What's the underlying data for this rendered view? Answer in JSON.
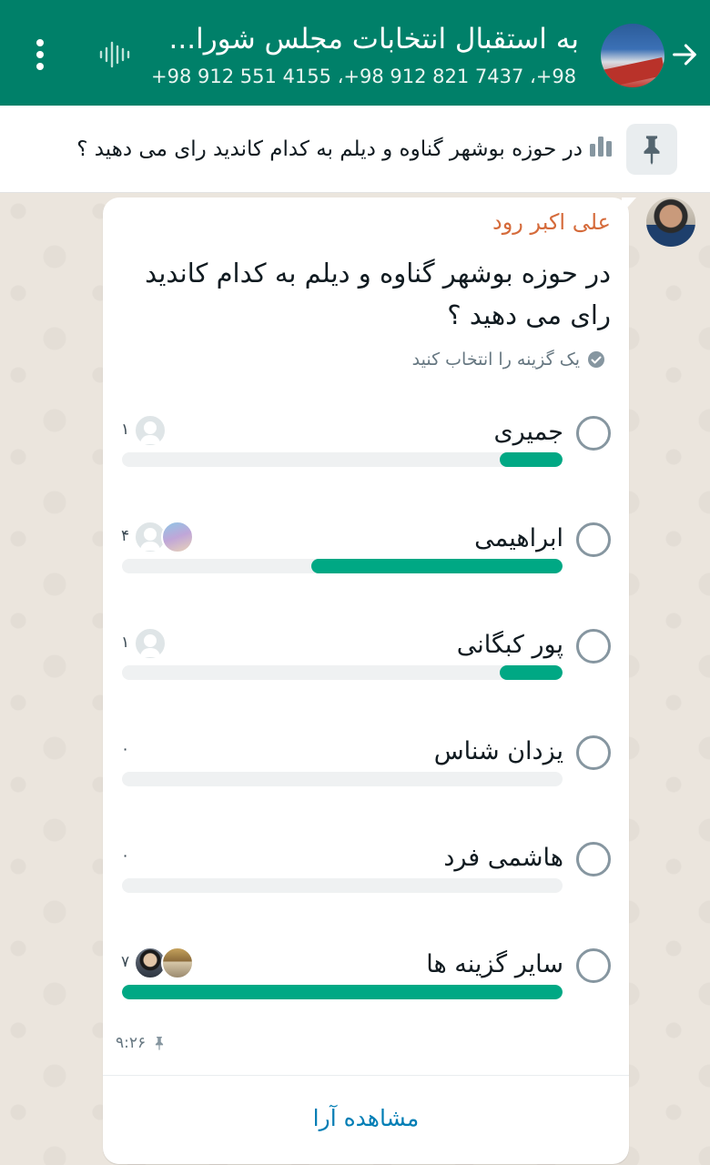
{
  "header": {
    "title": "به استقبال انتخابات مجلس شورا...",
    "subtitle": "+98 912 551 4155 ،+98 912 821 7437 ،+98 ...",
    "icons": {
      "back": "arrow-right-icon",
      "voice": "voice-chat-icon",
      "menu": "more-vertical-icon"
    },
    "color": "#008069"
  },
  "pinned": {
    "text": "در حوزه بوشهر گناوه و دیلم به کدام کاندید رای می دهید ؟",
    "icons": {
      "pin": "pin-icon",
      "poll": "poll-icon"
    }
  },
  "message": {
    "sender": "علی اکبر رود",
    "question": "در حوزه بوشهر گناوه و دیلم به کدام کاندید رای می دهید ؟",
    "hint": "یک گزینه را انتخاب کنید",
    "time": "۹:۲۶",
    "view_votes": "مشاهده آرا",
    "options": [
      {
        "label": "جمیری",
        "count": "۱",
        "fraction": 0.143
      },
      {
        "label": "ابراهیمی",
        "count": "۴",
        "fraction": 0.571
      },
      {
        "label": "پور کبگانی",
        "count": "۱",
        "fraction": 0.143
      },
      {
        "label": "یزدان شناس",
        "count": "۰",
        "fraction": 0
      },
      {
        "label": "هاشمی فرد",
        "count": "۰",
        "fraction": 0
      },
      {
        "label": "سایر گزینه ها",
        "count": "۷",
        "fraction": 1.0
      }
    ]
  },
  "colors": {
    "accent": "#00a884",
    "sender_name": "#d56b3b",
    "link": "#027eb5"
  }
}
